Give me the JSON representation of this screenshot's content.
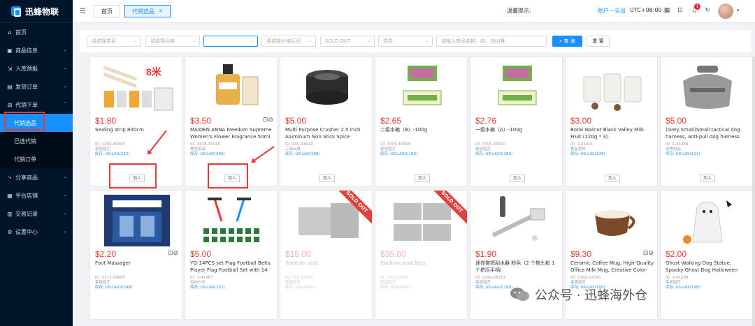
{
  "brand": "迅蜂物联",
  "sidebar": {
    "items": [
      {
        "label": "首页",
        "icon": "home-icon"
      },
      {
        "label": "商品信息",
        "icon": "box-icon"
      },
      {
        "label": "入库预报",
        "icon": "inbound-icon"
      },
      {
        "label": "发货订单",
        "icon": "order-icon"
      },
      {
        "label": "代销下单",
        "icon": "cart-icon"
      },
      {
        "label": "分享商品",
        "icon": "share-icon"
      },
      {
        "label": "平台店铺",
        "icon": "store-icon"
      },
      {
        "label": "交易记录",
        "icon": "record-icon"
      },
      {
        "label": "设置中心",
        "icon": "gear-icon"
      }
    ],
    "sub_items": [
      "代销选品",
      "已选代销",
      "代销订单"
    ],
    "active_sub": "代销选品"
  },
  "topbar": {
    "tabs": [
      {
        "label": "首页"
      },
      {
        "label": "代销选品"
      }
    ],
    "notice": "温馨提示:",
    "account": "账户一旦出",
    "timezone": "UTC+08:00",
    "badge_count": "1"
  },
  "filters": {
    "category": "请选择类目",
    "warehouse": "请选择仓库",
    "blank": "",
    "price_range": "请选择价格区间",
    "sold_out": "SOLD OUT",
    "supply": "供应",
    "search_placeholder": "请输入商品名称、ID、SKU等",
    "search_button": "查 询",
    "reset_button": "重 置"
  },
  "add_label": "加入",
  "products": [
    {
      "price": "$1.80",
      "title": "Sealing strip 800cm",
      "id": "ID: 1299-40093",
      "cat": "家居园艺",
      "stock": "库存: US-LAX(112)",
      "sold": false
    },
    {
      "price": "$3.50",
      "title": "MAIDEN ANNA Freedom Supreme Women's Flower Fragrance 50ml",
      "id": "ID: 2878-35035",
      "cat": "美妆用品",
      "stock": "库存: US-LAX(246)",
      "sold": false
    },
    {
      "price": "$5.00",
      "title": "Multi Purpose Crusher 2.5 Inch Aluminum Non Stick Spice Grinder ...",
      "id": "ID: 930-41619",
      "cat": "工具玩具",
      "stock": "库存: US-LAX(198)",
      "sold": false
    },
    {
      "price": "$2.65",
      "title": "二级水箱（B）-100g",
      "id": "ID: 3705-40494",
      "cat": "家居园艺",
      "stock": "库存: US-LAX2(180)",
      "sold": false
    },
    {
      "price": "$2.76",
      "title": "一级水箱（A）-100g",
      "id": "ID: 3705-40502",
      "cat": "家居园艺",
      "stock": "库存: US-LAX2(180)",
      "sold": false
    },
    {
      "price": "$3.00",
      "title": "Botal Walnut Black Valley Milk Fruit (120g * 3)",
      "id": "ID: 1-41491",
      "cat": "食品饮料",
      "stock": "库存: US-LAX(128)",
      "sold": false
    },
    {
      "price": "$5.00",
      "title": "(Grey,Small)Small tactical dog harness, anti-pull dog harness with ...",
      "id": "ID: 1-41488",
      "cat": "宠物用品",
      "stock": "库存: US-LAX(112)",
      "sold": false
    },
    {
      "price": "$2.20",
      "title": "Foot Massager",
      "id": "ID: 3173-39685",
      "cat": "家居园艺",
      "stock": "库存: US-LAX2(248)",
      "sold": false
    },
    {
      "price": "$5.00",
      "title": "YQ-14PCS set Flag Football Belts, Player Flag Football Set with 14 Fla...",
      "id": "ID: 1-41487",
      "cat": "运动户外",
      "stock": "库存: US-LAX(252)",
      "sold": false
    },
    {
      "price": "$15.00",
      "title": "Stadium seat",
      "id": "ID: 793-32413",
      "cat": "家居园艺",
      "stock": "库存: US-LAX(0)",
      "sold": true
    },
    {
      "price": "$35.00",
      "title": "Stadium seat 2pcs",
      "id": "ID: 793-32413",
      "cat": "家居园艺",
      "stock": "库存: US-LAX(0)",
      "sold": true
    },
    {
      "price": "$1.90",
      "title": "迷你拖把刮水器 粉色（2 个拖头和 1 个挤压手柄）",
      "id": "ID: 1299-28313",
      "cat": "家居园艺",
      "stock": "库存: US-LAX2(180)",
      "sold": false
    },
    {
      "price": "$9.30",
      "title": "Ceramic Coffee Mug, High-Quality Office Milk Mug, Creative Color-Bloc...",
      "id": "ID: 2358-32030",
      "cat": "家居园艺",
      "stock": "库存: US-LAX(100)",
      "sold": false
    },
    {
      "price": "$2.00",
      "title": "Ghost Walking Dog Statue, Spooky Ghost Dog Halloween Figurine, Fun...",
      "id": "ID: 1-41288",
      "cat": "家居园艺",
      "stock": "库存: US-LAX(195)",
      "sold": false
    }
  ],
  "sold_out_label": "SOLD OUT",
  "watermark": "公众号 · 迅蜂海外仓"
}
